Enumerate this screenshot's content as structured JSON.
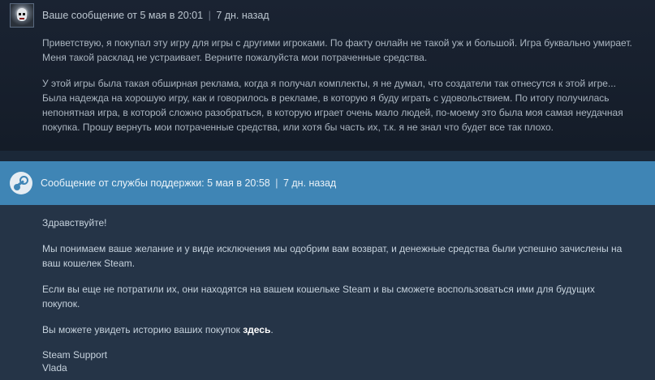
{
  "user_message": {
    "header_prefix": "Ваше сообщение от 5 мая в 20:01",
    "header_separator": "|",
    "header_age": "7 дн. назад",
    "paragraphs": [
      "Приветствую, я покупал эту игру для игры с другими игроками. По факту онлайн не такой уж и большой. Игра буквально умирает. Меня такой расклад не устраивает. Верните пожалуйста мои потраченные средства.",
      "У этой игры была такая обширная реклама, когда я получал комплекты, я не думал, что создатели так отнесутся к этой игре... Была надежда на хорошую игру, как и говорилось в рекламе, в которую я буду играть с удовольствием. По итогу получилась непонятная игра, в которой сложно разобраться, в которую играет очень мало людей, по-моему это была моя самая неудачная покупка. Прошу вернуть мои потраченные средства, или хотя бы часть их, т.к. я не знал что будет все так плохо."
    ]
  },
  "support_message": {
    "header_prefix": "Сообщение от службы поддержки: 5 мая в 20:58",
    "header_separator": "|",
    "header_age": "7 дн. назад",
    "greeting": "Здравствуйте!",
    "paragraph_refund": "Мы понимаем ваше желание  и у виде исключения мы одобрим вам возврат, и денежные средства были успешно зачислены на ваш кошелек Steam.",
    "paragraph_wallet": "Если вы еще не потратили их, они находятся на вашем кошельке Steam и вы сможете воспользоваться ими для будущих покупок.",
    "history_text": "Вы можете увидеть историю ваших покупок ",
    "history_link": "здесь",
    "history_end": ".",
    "signature_line1": "Steam Support",
    "signature_line2": "Vlada"
  },
  "icons": {
    "user_avatar": "avatar",
    "support_avatar": "steam-logo-icon"
  },
  "colors": {
    "support_header": "#3f85b5",
    "user_bg": "#1a2332",
    "support_bg": "#253447",
    "link": "#ffffff"
  }
}
